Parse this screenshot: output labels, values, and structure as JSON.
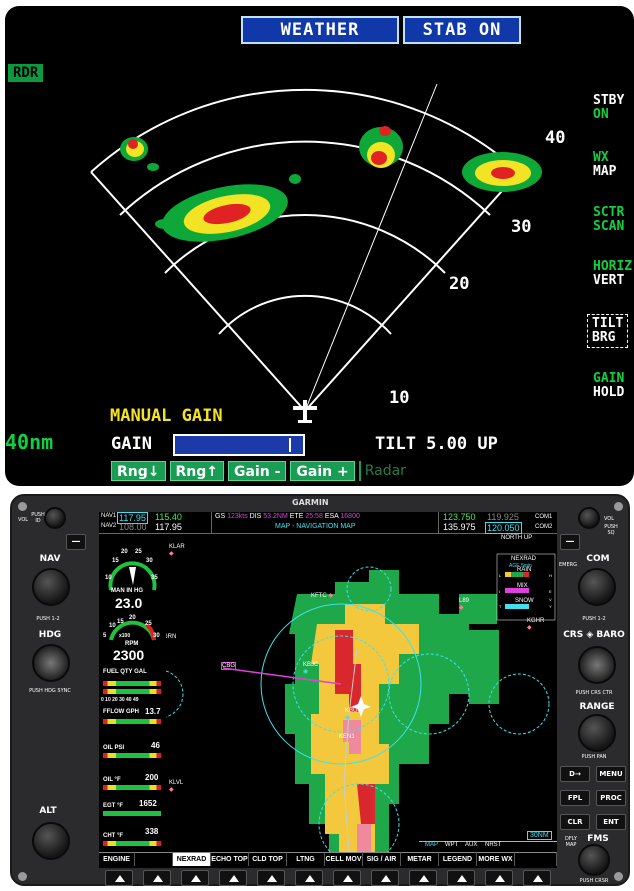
{
  "radar": {
    "header_buttons": [
      "WEATHER",
      "STAB ON"
    ],
    "mode": "RDR",
    "side_menu": [
      {
        "top": "STBY",
        "bottom": "ON"
      },
      {
        "top": "WX",
        "bottom": "MAP"
      },
      {
        "top": "SCTR",
        "bottom": "SCAN"
      },
      {
        "top": "HORIZ",
        "bottom": "VERT"
      },
      {
        "top": "TILT",
        "bottom": "BRG"
      },
      {
        "top": "GAIN",
        "bottom": "HOLD"
      }
    ],
    "range_labels": [
      "40",
      "30",
      "20",
      "10"
    ],
    "manual_gain": "MANUAL GAIN",
    "range": "40nm",
    "gain_label": "GAIN",
    "tilt": "TILT 5.00 UP",
    "softkeys": [
      "Rng↓",
      "Rng↑",
      "Gain -",
      "Gain +"
    ],
    "softkey_dim": "Radar"
  },
  "unit": {
    "brand": "GARMIN",
    "left_labels": {
      "vol": "VOL",
      "push_id": "PUSH ID",
      "nav": "NAV",
      "push_12": "PUSH 1-2",
      "hdg": "HDG",
      "push_hdg": "PUSH HDG SYNC",
      "alt": "ALT"
    },
    "right_labels": {
      "vol": "VOL",
      "push_sq": "PUSH SQ",
      "com": "COM",
      "emerg": "EMERG",
      "push_12": "PUSH 1-2",
      "crs_baro": "CRS ◈ BARO",
      "push_crs": "PUSH CRS CTR",
      "range": "RANGE",
      "push_pan": "PUSH PAN",
      "fms": "FMS",
      "dfly": "DFLY MAP",
      "push_crsr": "PUSH CRSR"
    },
    "right_buttons": [
      "D→",
      "MENU",
      "FPL",
      "PROC",
      "CLR",
      "ENT"
    ]
  },
  "screen": {
    "nav1_active": "117.95",
    "nav1_standby": "115.40",
    "nav2_active": "108.00",
    "nav2_standby": "117.95",
    "nav1_label": "NAV1",
    "nav2_label": "NAV2",
    "status": {
      "gs_label": "GS",
      "gs": "123kts",
      "dis_label": "DIS",
      "dis": "53.2NM",
      "ete_label": "ETE",
      "ete": "25:58",
      "esa_label": "ESA",
      "esa": "16800"
    },
    "page_title": "MAP - NAVIGATION MAP",
    "com1_active": "123.750",
    "com1_standby": "119.925",
    "com2_active": "135.975",
    "com2_standby": "120.050",
    "com1_label": "COM1",
    "com2_label": "COM2",
    "orientation": "NORTH UP",
    "legend": {
      "title": "NEXRAD",
      "age": "AGE 5min",
      "rain": "RAIN",
      "mix": "MIX",
      "snow": "SNOW",
      "l": "L",
      "h": "H",
      "i": "I",
      "e": "E",
      "t": "T",
      "v": "V",
      "y": "Y"
    },
    "airports": [
      "KLAR",
      "KFTC",
      "L89",
      "KGHR",
      "KBJC",
      "KBUC",
      "KLVL",
      "GRN",
      "KEN1",
      "CBG"
    ],
    "map_range": "30NM",
    "map_tabs": [
      "MAP",
      "WPT",
      "AUX",
      "NRST"
    ],
    "engine": {
      "man_label": "MAN IN HG",
      "man_value": "23.0",
      "rpm_label": "RPM",
      "rpm_value": "2300",
      "fuel_label": "FUEL QTY GAL",
      "fuel_ticks": "0  10  20  30  40  49",
      "fflow_label": "FFLOW GPH",
      "fflow_value": "13.7",
      "oilpsi_label": "OIL PSI",
      "oilpsi_value": "46",
      "oilf_label": "OIL °F",
      "oilf_value": "200",
      "egt_label": "EGT °F",
      "egt_value": "1652",
      "cht_label": "CHT °F",
      "cht_value": "338",
      "man_ticks": [
        "10",
        "15",
        "20",
        "25",
        "30",
        "35"
      ],
      "rpm_ticks": [
        "5",
        "10",
        "15",
        "20",
        "25",
        "30"
      ],
      "rpm_mult": "x100"
    },
    "softkeys": [
      "ENGINE",
      "",
      "NEXRAD",
      "ECHO TOP",
      "CLD TOP",
      "LTNG",
      "CELL MOV",
      "SIG / AIR",
      "METAR",
      "LEGEND",
      "MORE WX",
      ""
    ],
    "selected_softkey": "NEXRAD"
  },
  "colors": {
    "radar_green": "#0ea838",
    "radar_yellow": "#f2e324",
    "radar_red": "#e02222",
    "nexrad_green": "#1fa84a",
    "nexrad_yellow": "#f4c83c",
    "nexrad_red": "#d8282e",
    "cyan": "#3fe0f0",
    "magenta": "#e040e0"
  }
}
